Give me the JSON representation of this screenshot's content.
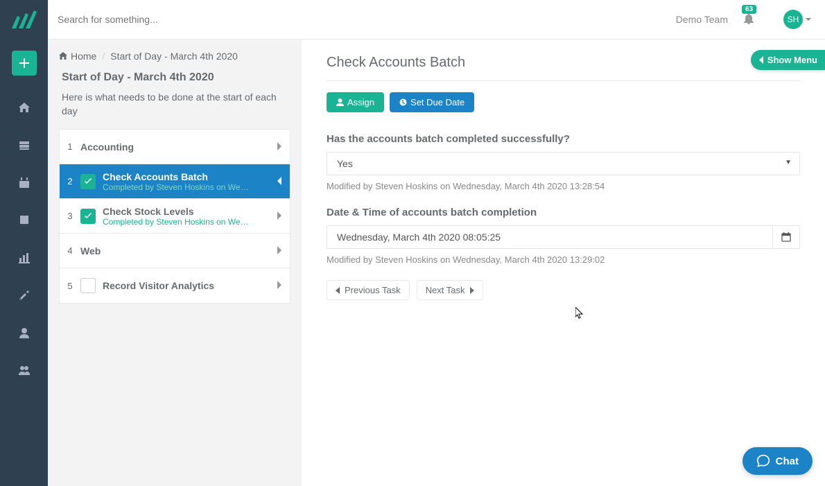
{
  "header": {
    "search_placeholder": "Search for something...",
    "team": "Demo Team",
    "notif_count": "63",
    "avatar_initials": "SH"
  },
  "breadcrumb": {
    "home": "Home",
    "current": "Start of Day - March 4th 2020"
  },
  "panel": {
    "title": "Start of Day - March 4th 2020",
    "desc": "Here is what needs to be done at the start of each day"
  },
  "tasks": [
    {
      "num": "1",
      "title": "Accounting",
      "type": "section"
    },
    {
      "num": "2",
      "title": "Check Accounts Batch",
      "sub": "Completed by Steven Hoskins on We…",
      "done": true,
      "active": true
    },
    {
      "num": "3",
      "title": "Check Stock Levels",
      "sub": "Completed by Steven Hoskins on We…",
      "done": true
    },
    {
      "num": "4",
      "title": "Web",
      "type": "section"
    },
    {
      "num": "5",
      "title": "Record Visitor Analytics",
      "done": false
    }
  ],
  "main": {
    "title": "Check Accounts Batch",
    "show_menu": "Show Menu",
    "assign_btn": "Assign",
    "due_btn": "Set Due Date",
    "q1_label": "Has the accounts batch completed successfully?",
    "q1_value": "Yes",
    "q1_meta": "Modified by Steven Hoskins on Wednesday, March 4th 2020 13:28:54",
    "q2_label": "Date & Time of accounts batch completion",
    "q2_value": "Wednesday, March 4th 2020 08:05:25",
    "q2_meta": "Modified by Steven Hoskins on Wednesday, March 4th 2020 13:29:02",
    "prev_btn": "Previous Task",
    "next_btn": "Next Task"
  },
  "chat_label": "Chat"
}
